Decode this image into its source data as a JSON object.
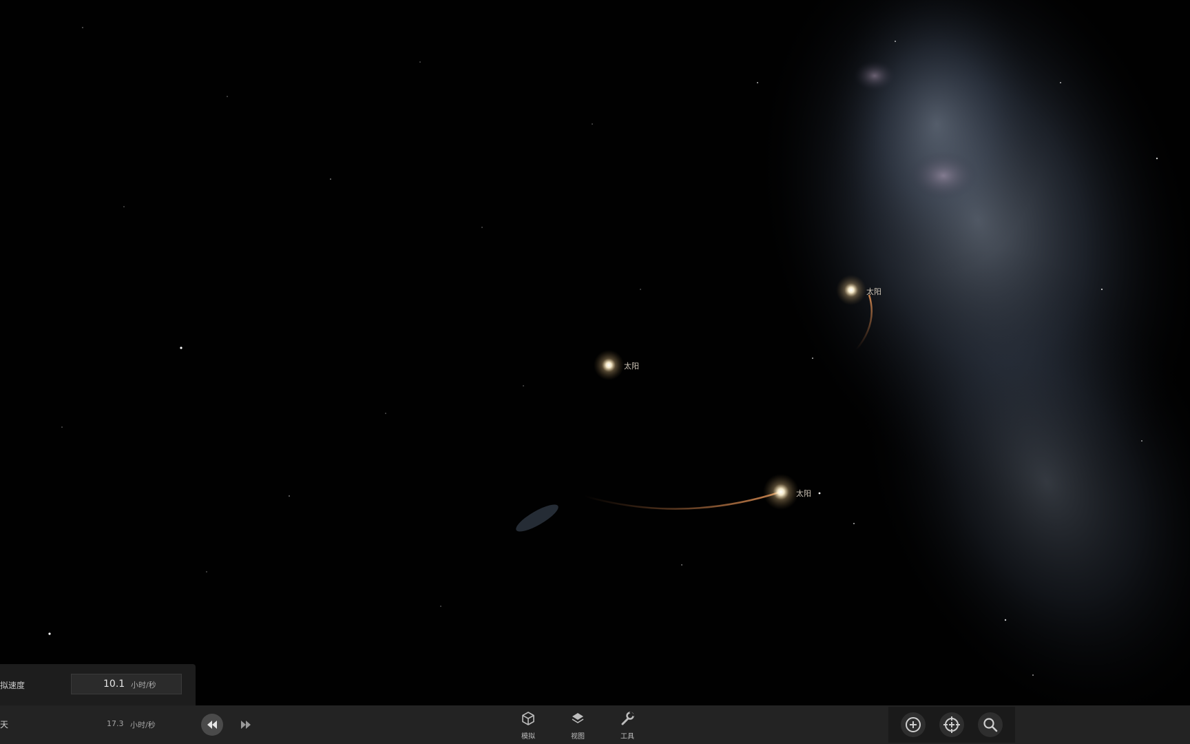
{
  "scene": {
    "star_labels": [
      "太阳",
      "太阳",
      "太阳"
    ]
  },
  "speed_panel": {
    "label": "拟速度",
    "value": "10.1",
    "unit": "小时/秒"
  },
  "bottom_bar": {
    "day_label": "天",
    "rate_value": "17.3",
    "rate_unit": "小时/秒",
    "tabs": [
      {
        "label": "模拟",
        "icon": "cube-icon"
      },
      {
        "label": "视图",
        "icon": "layers-icon"
      },
      {
        "label": "工具",
        "icon": "wrench-icon"
      }
    ],
    "tools": [
      {
        "icon": "zoom-in-icon"
      },
      {
        "icon": "recenter-icon"
      },
      {
        "icon": "search-icon"
      }
    ]
  },
  "colors": {
    "background": "#000000",
    "bar": "#232323",
    "panel": "#1d1d1d",
    "orbit_trail": "#b36b3a",
    "star_glow": "#ffe9b8"
  }
}
